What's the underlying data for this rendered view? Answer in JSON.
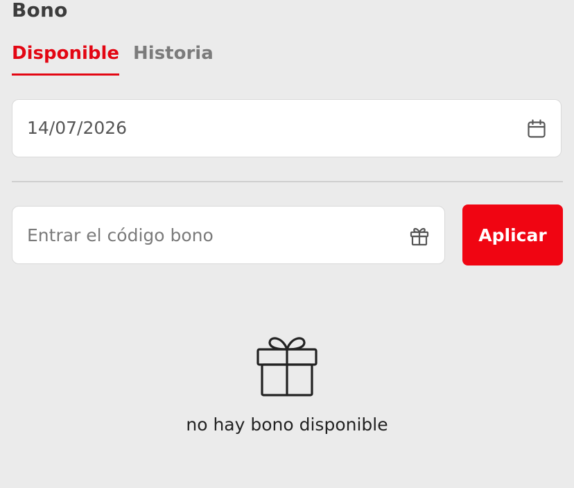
{
  "header": {
    "title": "Bono"
  },
  "tabs": [
    {
      "label": "Disponible",
      "active": true
    },
    {
      "label": "Historia",
      "active": false
    }
  ],
  "date_filter": {
    "value": "14/07/2026",
    "icon": "calendar-icon"
  },
  "coupon": {
    "placeholder": "Entrar el código bono",
    "value": "",
    "icon": "gift-icon",
    "apply_label": "Aplicar"
  },
  "empty_state": {
    "icon": "gift-icon",
    "message": "no hay bono disponible"
  },
  "colors": {
    "accent": "#e30613",
    "button_bg": "#f00512",
    "background": "#ebebeb",
    "inactive_tab": "#7b7b7b"
  }
}
